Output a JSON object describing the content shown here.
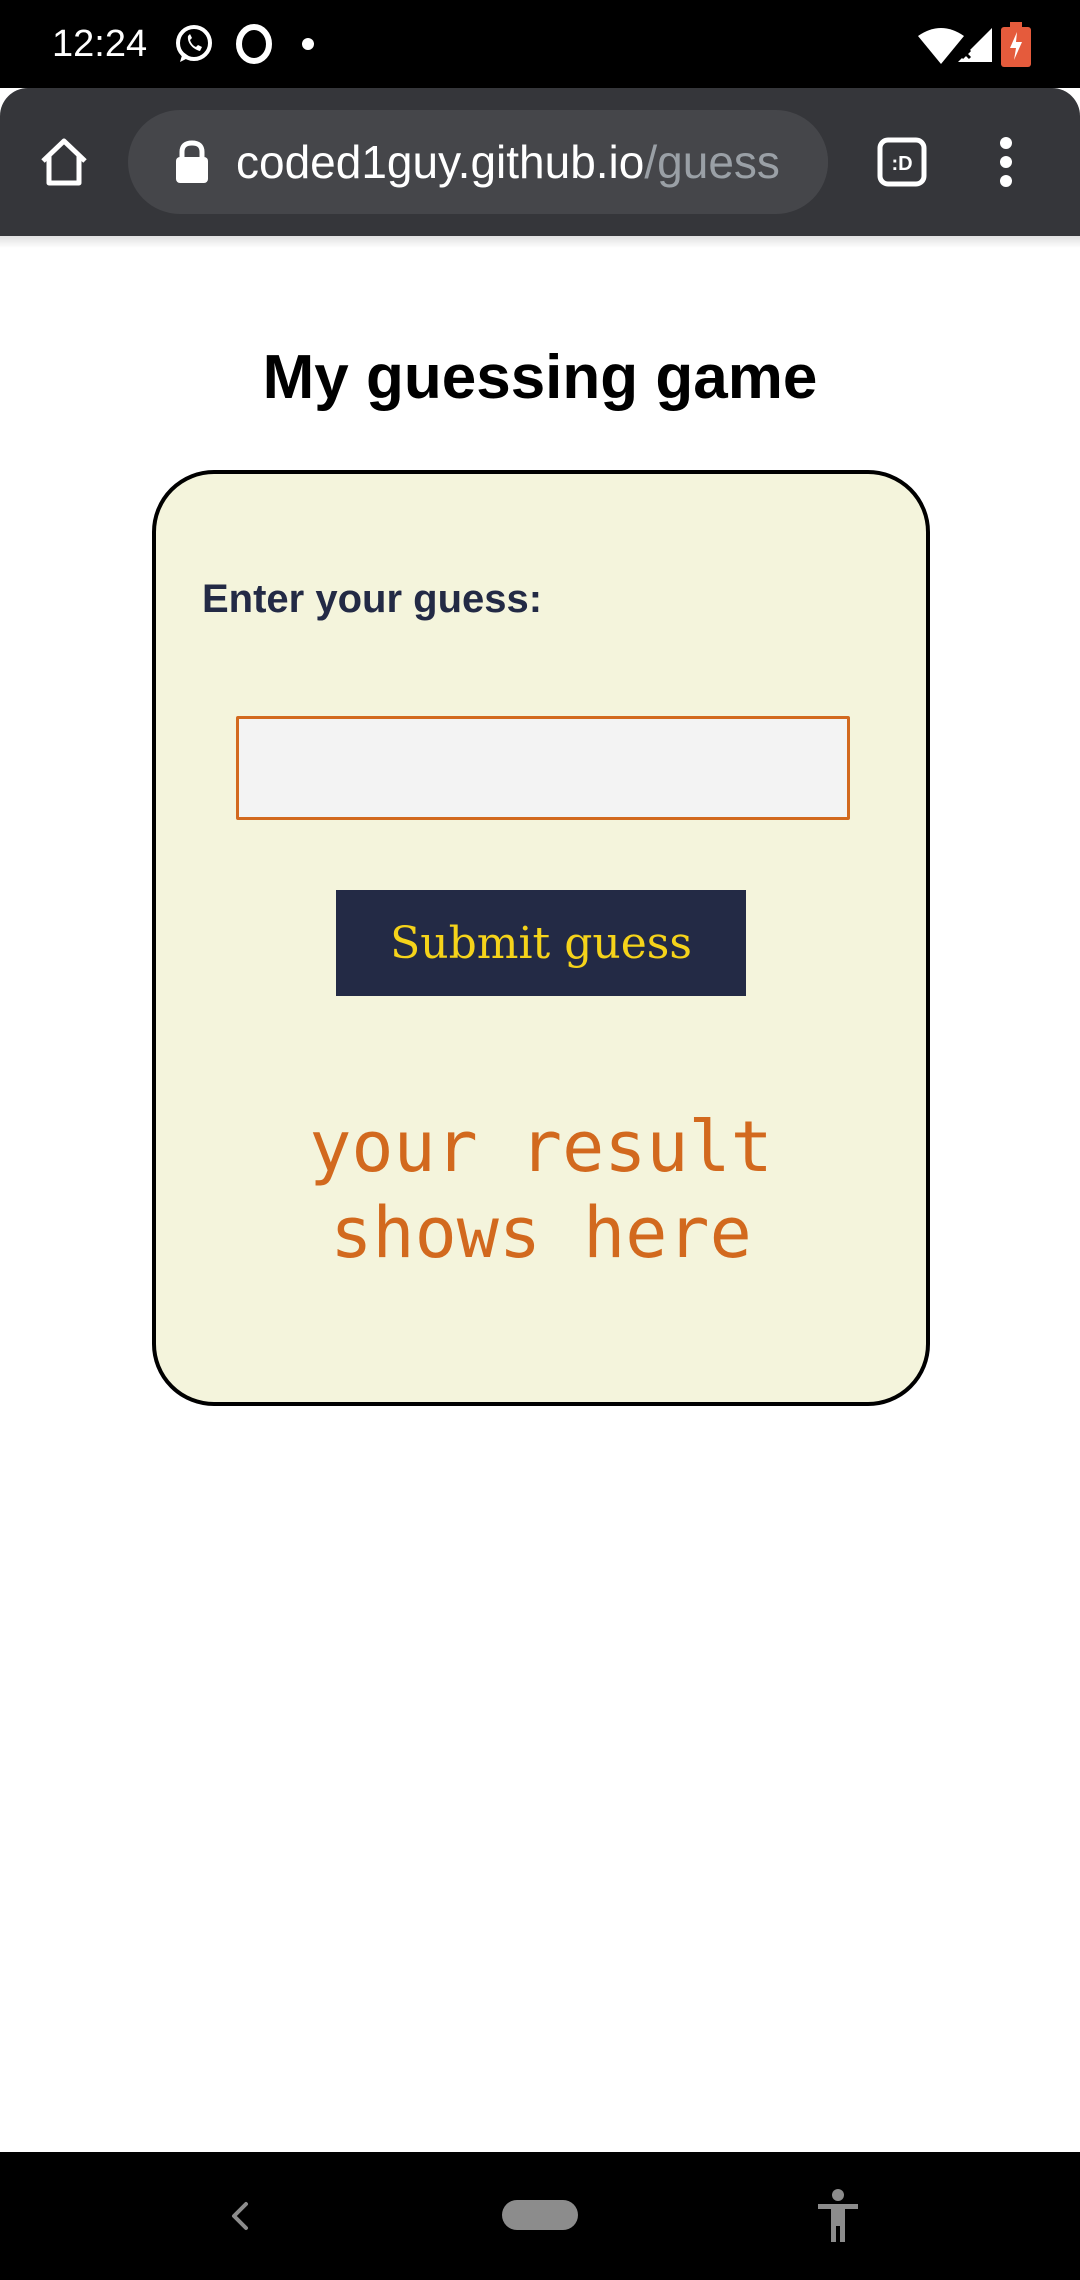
{
  "status_bar": {
    "time": "12:24",
    "icons": [
      "whatsapp-icon",
      "opera-icon",
      "notification-dot",
      "wifi-icon",
      "signal-icon",
      "battery-icon"
    ]
  },
  "browser": {
    "url_host": "coded1guy.github.io",
    "url_path": "/guess",
    "tab_switcher_label": ":D",
    "icons": [
      "home-icon",
      "lock-icon",
      "tab-switcher-icon",
      "menu-icon"
    ]
  },
  "page": {
    "title": "My guessing game",
    "form": {
      "label": "Enter your guess:",
      "input_value": "",
      "submit_label": "Submit guess"
    },
    "result": {
      "line1": "your result",
      "line2": "shows here"
    }
  },
  "colors": {
    "card_background": "#f4f4dc",
    "button_background": "#232a45",
    "button_text": "#f5d31a",
    "accent_orange": "#d2691e",
    "label_text": "#232a45"
  },
  "nav_bar": {
    "icons": [
      "back-icon",
      "home-pill",
      "accessibility-icon"
    ]
  }
}
